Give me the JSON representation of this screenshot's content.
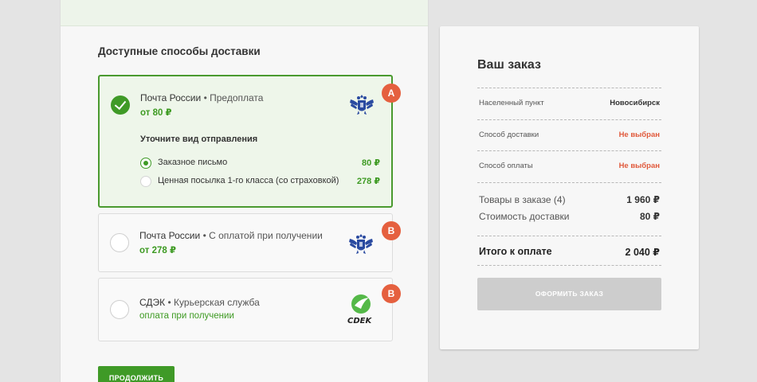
{
  "delivery": {
    "section_title": "Доступные способы доставки",
    "methods": [
      {
        "carrier": "Почта России",
        "subtitle": "Предоплата",
        "price": "от 80 ₽",
        "logo": "russian-post-eagle-icon",
        "badge": "А",
        "selected": true,
        "options_title": "Уточните вид отправления",
        "options": [
          {
            "label": "Заказное письмо",
            "price": "80 ₽",
            "selected": true
          },
          {
            "label": "Ценная посылка 1-го класса (со страховкой)",
            "price": "278 ₽",
            "selected": false
          }
        ]
      },
      {
        "carrier": "Почта России",
        "subtitle": "С оплатой при получении",
        "price": "от 278 ₽",
        "logo": "russian-post-eagle-icon",
        "badge": "В",
        "selected": false
      },
      {
        "carrier": "СДЭК",
        "subtitle": "Курьерская служба",
        "price": "оплата при получении",
        "logo": "cdek-logo",
        "badge": "В",
        "selected": false
      }
    ],
    "continue_label": "ПРОДОЛЖИТЬ"
  },
  "order": {
    "title": "Ваш заказ",
    "city_label": "Населенный пункт",
    "city_value": "Новосибирск",
    "delivery_label": "Способ доставки",
    "delivery_value": "Не выбран",
    "payment_label": "Способ оплаты",
    "payment_value": "Не выбран",
    "items_label": "Товары в заказе (4)",
    "items_value": "1 960 ₽",
    "shipping_label": "Стоимость доставки",
    "shipping_value": "80 ₽",
    "total_label": "Итого к оплате",
    "total_value": "2 040 ₽",
    "checkout_label": "ОФОРМИТЬ ЗАКАЗ"
  },
  "colors": {
    "accent_green": "#3f9a27",
    "warning_red": "#e05a3c",
    "badge_orange": "#e5603f",
    "post_blue": "#2a4aa0"
  }
}
